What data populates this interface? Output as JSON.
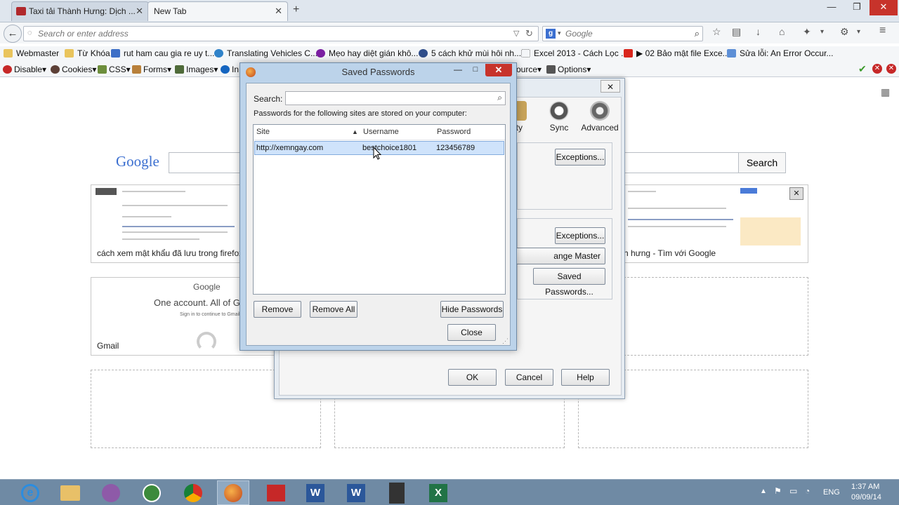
{
  "browser": {
    "tabs": [
      {
        "label": "Taxi tải Thành Hưng: Dịch ...",
        "active": false
      },
      {
        "label": "New Tab",
        "active": true
      }
    ],
    "address_placeholder": "Search or enter address",
    "search_engine": "Google",
    "search_placeholder": "Google"
  },
  "bookmarks": [
    "Webmaster",
    "Từ Khóa",
    "rut ham cau gia re uy t...",
    "Translating Vehicles C...",
    "Mẹo hay diệt gián khô...",
    "5 cách khử mùi hôi nh...",
    "Excel 2013 - Cách Lọc ...",
    "▶ 02 Bảo mật file Exce...",
    "Sửa lỗi: An Error Occur..."
  ],
  "devbar": {
    "items": [
      "Disable▾",
      "Cookies▾",
      "CSS▾",
      "Forms▾",
      "Images▾",
      "In"
    ],
    "right_items": [
      "ource▾",
      "Options▾"
    ]
  },
  "newtab": {
    "logo_text": "Google",
    "search_button": "Search",
    "tiles": [
      {
        "caption": "cách xem mật khẩu đã lưu trong firefox -"
      },
      {
        "caption": "h hưng - Tìm với Google"
      },
      {
        "caption": "Gmail",
        "heading": "Google",
        "text": "One account. All of Go",
        "subtext": "Sign in to continue to Gmail"
      }
    ]
  },
  "options_dialog": {
    "tabs": [
      "ity",
      "Sync",
      "Advanced"
    ],
    "buttons": {
      "exceptions1": "Exceptions...",
      "exceptions2": "Exceptions...",
      "master_password": "ange Master Password...",
      "saved_passwords": "Saved Passwords...",
      "ok": "OK",
      "cancel": "Cancel",
      "help": "Help"
    }
  },
  "saved_passwords": {
    "title": "Saved Passwords",
    "search_label": "Search:",
    "info": "Passwords for the following sites are stored on your computer:",
    "columns": [
      "Site",
      "Username",
      "Password"
    ],
    "rows": [
      {
        "site": "http://xemngay.com",
        "username": "bestchoice1801",
        "password": "123456789"
      }
    ],
    "buttons": {
      "remove": "Remove",
      "remove_all": "Remove All",
      "hide_passwords": "Hide Passwords",
      "close": "Close"
    }
  },
  "taskbar": {
    "language": "ENG",
    "time": "1:37 AM",
    "date": "09/09/14"
  }
}
